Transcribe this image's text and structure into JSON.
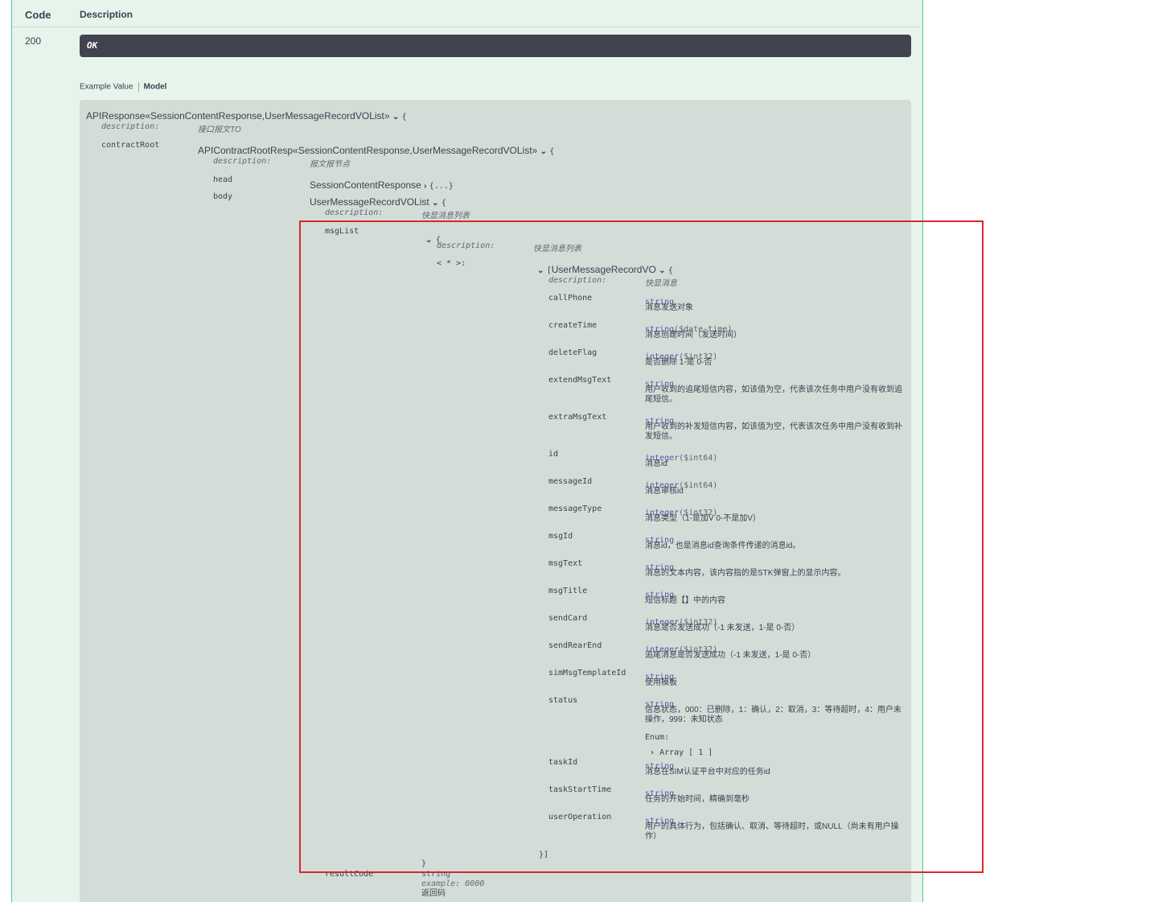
{
  "header": {
    "code_label": "Code",
    "description_label": "Description"
  },
  "response": {
    "code": "200",
    "status": "OK"
  },
  "tabs": {
    "example": "Example Value",
    "model": "Model"
  },
  "model": {
    "root_name": "APIResponse«SessionContentResponse,UserMessageRecordVOList»",
    "open_brace": "{",
    "desc_key": "description:",
    "root_desc": "接口报文TO",
    "contract_root_key": "contractRoot",
    "contract_name": "APIContractRootResp«SessionContentResponse,UserMessageRecordVOList»",
    "contract_desc": "报文报节点",
    "head_key": "head",
    "head_type": "SessionContentResponse",
    "head_collapsed": "{...}",
    "body_key": "body",
    "body_type": "UserMessageRecordVOList",
    "body_desc": "快显消息列表",
    "msglist_key": "msgList",
    "msglist_desc": "快显消息列表",
    "map_key": "< * >:",
    "item_open": "[",
    "item_name": "UserMessageRecordVO",
    "item_desc": "快显消息",
    "item_close": "}]",
    "close_brace": "}",
    "result_code_key": "resultCode",
    "result_code_type": "string",
    "result_code_example": "example: 0000",
    "result_code_desc": "返回码"
  },
  "props": [
    {
      "name": "callPhone",
      "type": "string",
      "fmt": "",
      "desc": "消息发送对象"
    },
    {
      "name": "createTime",
      "type": "string",
      "fmt": "($date-time)",
      "desc": "消息创建时间（发送时间）"
    },
    {
      "name": "deleteFlag",
      "type": "integer",
      "fmt": "($int32)",
      "desc": "是否删除 1-是 0-否"
    },
    {
      "name": "extendMsgText",
      "type": "string",
      "fmt": "",
      "desc": "用户收到的追尾短信内容，如该值为空，代表该次任务中用户没有收到追尾短信。"
    },
    {
      "name": "extraMsgText",
      "type": "string",
      "fmt": "",
      "desc": "用户收到的补发短信内容，如该值为空，代表该次任务中用户没有收到补发短信。"
    },
    {
      "name": "id",
      "type": "integer",
      "fmt": "($int64)",
      "desc": "消息id"
    },
    {
      "name": "messageId",
      "type": "integer",
      "fmt": "($int64)",
      "desc": "消息审核id"
    },
    {
      "name": "messageType",
      "type": "integer",
      "fmt": "($int32)",
      "desc": "消息类型（1-是加V 0-不是加V）"
    },
    {
      "name": "msgId",
      "type": "string",
      "fmt": "",
      "desc": "消息id，也是消息id查询条件传递的消息id。"
    },
    {
      "name": "msgText",
      "type": "string",
      "fmt": "",
      "desc": "消息的文本内容，该内容指的是STK弹窗上的显示内容。"
    },
    {
      "name": "msgTitle",
      "type": "string",
      "fmt": "",
      "desc": "短信标题【】中的内容"
    },
    {
      "name": "sendCard",
      "type": "integer",
      "fmt": "($int32)",
      "desc": "消息是否发送成功（-1 未发送，1-是 0-否）"
    },
    {
      "name": "sendRearEnd",
      "type": "integer",
      "fmt": "($int32)",
      "desc": "追尾消息是否发送成功（-1 未发送，1-是 0-否）"
    },
    {
      "name": "simMsgTemplateId",
      "type": "string",
      "fmt": "",
      "desc": "使用模板"
    },
    {
      "name": "status",
      "type": "string",
      "fmt": "",
      "desc": "信息状态，000：已删除，1：确认，2：取消，3：等待超时，4：用户未操作，999：未知状态"
    },
    {
      "name": "taskId",
      "type": "string",
      "fmt": "",
      "desc": "消息在SIM认证平台中对应的任务id"
    },
    {
      "name": "taskStartTime",
      "type": "string",
      "fmt": "",
      "desc": "任务的开始时间，精确到毫秒"
    },
    {
      "name": "userOperation",
      "type": "string",
      "fmt": "",
      "desc": "用户的具体行为，包括确认、取消、等待超时，或NULL（尚未有用户操作）"
    }
  ],
  "status_enum": {
    "label": "Enum:",
    "array": "Array [ 1 ]"
  },
  "highlight_color": "#e0242c"
}
